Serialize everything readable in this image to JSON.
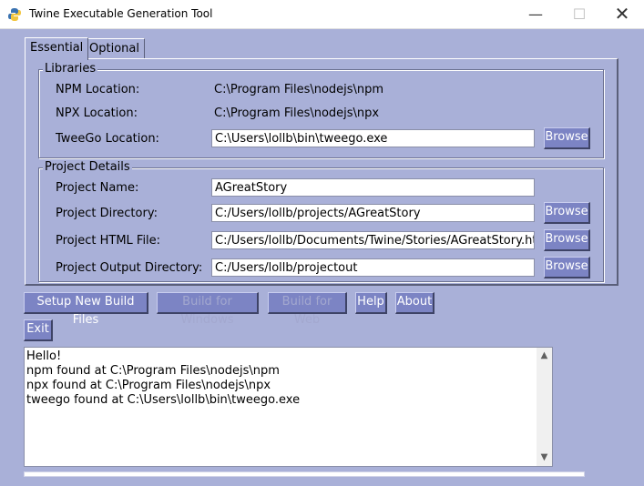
{
  "window": {
    "title": "Twine Executable Generation Tool",
    "min_glyph": "—",
    "max_glyph": "☐",
    "close_glyph": "✕"
  },
  "tabs": [
    {
      "label": "Essential",
      "selected": true
    },
    {
      "label": "Optional",
      "selected": false
    }
  ],
  "libraries": {
    "legend": "Libraries",
    "npm_label": "NPM Location:",
    "npm_value": "C:\\Program Files\\nodejs\\npm",
    "npx_label": "NPX Location:",
    "npx_value": "C:\\Program Files\\nodejs\\npx",
    "tweego_label": "TweeGo Location:",
    "tweego_value": "C:\\Users\\lollb\\bin\\tweego.exe"
  },
  "project": {
    "legend": "Project Details",
    "name_label": "Project Name:",
    "name_value": "AGreatStory",
    "dir_label": "Project Directory:",
    "dir_value": "C:/Users/lollb/projects/AGreatStory",
    "html_label": "Project HTML File:",
    "html_value": "C:/Users/lollb/Documents/Twine/Stories/AGreatStory.html",
    "out_label": "Project Output Directory:",
    "out_value": "C:/Users/lollb/projectout"
  },
  "browse_label": "Browse",
  "actions": {
    "setup": "Setup New Build Files",
    "build_windows": "Build for Windows",
    "build_web": "Build for Web",
    "help": "Help",
    "about": "About",
    "exit": "Exit"
  },
  "log_lines": [
    "Hello!",
    "npm found at C:\\Program Files\\nodejs\\npm",
    "npx found at C:\\Program Files\\nodejs\\npx",
    "tweego found at C:\\Users\\lollb\\bin\\tweego.exe"
  ],
  "progress_percent": 0,
  "colors": {
    "background": "#a9b0d8",
    "button": "#7c84c4",
    "button_text": "#ffffff"
  },
  "icons": {
    "app": "python-feather-icon",
    "scroll_up": "scroll-up-arrow-icon",
    "scroll_down": "scroll-down-arrow-icon"
  }
}
